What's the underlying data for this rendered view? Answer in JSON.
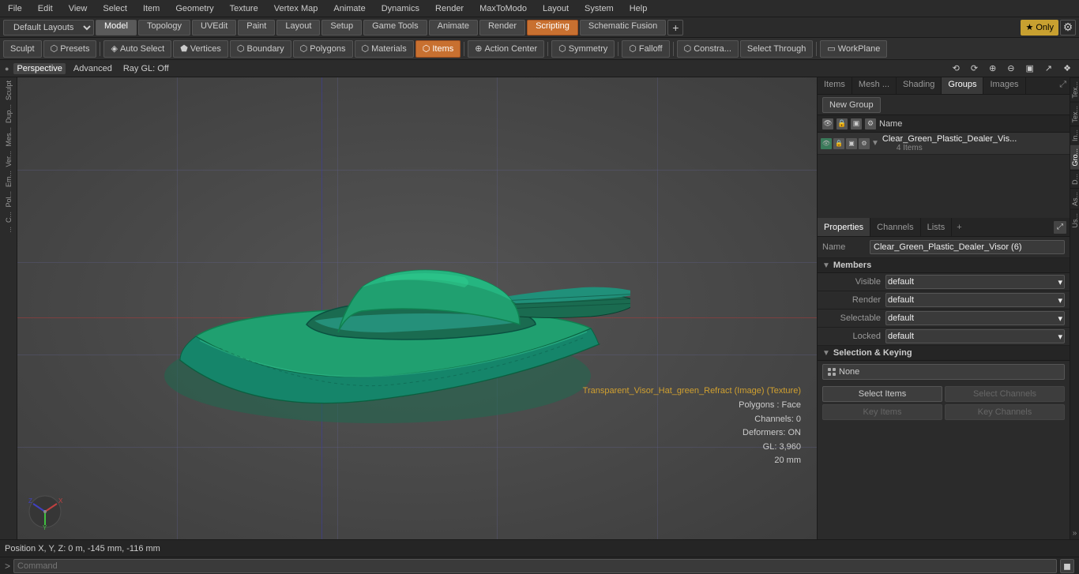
{
  "menu": {
    "items": [
      "File",
      "Edit",
      "View",
      "Select",
      "Item",
      "Geometry",
      "Texture",
      "Vertex Map",
      "Animate",
      "Dynamics",
      "Render",
      "MaxToModo",
      "Layout",
      "System",
      "Help"
    ]
  },
  "layout_bar": {
    "dropdown": "Default Layouts",
    "tabs": [
      "Model",
      "Topology",
      "UVEdit",
      "Paint",
      "Layout",
      "Setup",
      "Game Tools",
      "Animate",
      "Render",
      "Scripting",
      "Schematic Fusion"
    ],
    "active_tab": "Model",
    "scripting_tab": "Scripting",
    "add_btn": "+",
    "star_label": "★ Only",
    "settings_icon": "⚙"
  },
  "toolbar": {
    "sculpt_label": "Sculpt",
    "presets_label": "Presets",
    "auto_select_label": "Auto Select",
    "vertices_label": "Vertices",
    "boundary_label": "Boundary",
    "polygons_label": "Polygons",
    "materials_label": "Materials",
    "items_label": "Items",
    "action_center_label": "Action Center",
    "symmetry_label": "Symmetry",
    "falloff_label": "Falloff",
    "constraints_label": "Constra...",
    "select_through_label": "Select Through",
    "workplane_label": "WorkPlane"
  },
  "viewport_bar": {
    "dot": "●",
    "perspective_label": "Perspective",
    "advanced_label": "Advanced",
    "ray_gl_label": "Ray GL: Off",
    "icons": [
      "⟲",
      "⟳",
      "⊕",
      "⊖",
      "▣",
      "↗",
      "❖"
    ]
  },
  "left_sidebar": {
    "items": [
      "S",
      "c",
      "u",
      "l",
      "p",
      "t",
      "D",
      "u",
      "p",
      "...",
      "M",
      "e",
      "s",
      "...",
      "V",
      "e",
      "r",
      "...",
      "E",
      "m",
      "...",
      "P",
      "o",
      "l",
      "...",
      "C",
      "...",
      "..."
    ]
  },
  "viewport": {
    "status_text": "Transparent_Visor_Hat_green_Refract (Image) (Texture)",
    "polygons_label": "Polygons : Face",
    "channels_label": "Channels: 0",
    "deformers_label": "Deformers: ON",
    "gl_label": "GL: 3,960",
    "size_label": "20 mm"
  },
  "right_panel": {
    "tabs": [
      "Items",
      "Mesh ...",
      "Shading",
      "Groups",
      "Images"
    ],
    "active_tab": "Groups",
    "expand_icon": "⤢",
    "new_group_label": "New Group",
    "list_header": {
      "name_label": "Name"
    },
    "group_item": {
      "name": "Clear_Green_Plastic_Dealer_Vis...",
      "sub_text": "4 Items"
    }
  },
  "properties": {
    "tabs": [
      "Properties",
      "Channels",
      "Lists"
    ],
    "active_tab": "Properties",
    "add_tab": "+",
    "name_label": "Name",
    "name_value": "Clear_Green_Plastic_Dealer_Visor (6)",
    "sections": {
      "members": {
        "title": "Members",
        "rows": [
          {
            "label": "Visible",
            "value": "default"
          },
          {
            "label": "Render",
            "value": "default"
          },
          {
            "label": "Selectable",
            "value": "default"
          },
          {
            "label": "Locked",
            "value": "default"
          }
        ]
      },
      "selection_keying": {
        "title": "Selection & Keying",
        "none_label": "None",
        "buttons": [
          {
            "label": "Select Items",
            "enabled": true
          },
          {
            "label": "Select Channels",
            "enabled": false
          },
          {
            "label": "Key Items",
            "enabled": false
          },
          {
            "label": "Key Channels",
            "enabled": false
          }
        ]
      }
    }
  },
  "right_edge_tabs": [
    "Tex...",
    "Tex...",
    "In...",
    "Gro...",
    "D...",
    "As...",
    "Us..."
  ],
  "bottom_bar": {
    "position_text": "Position X, Y, Z:  0 m, -145 mm, -116 mm"
  },
  "command_bar": {
    "arrow": ">",
    "placeholder": "Command",
    "end_icon": "◼"
  }
}
